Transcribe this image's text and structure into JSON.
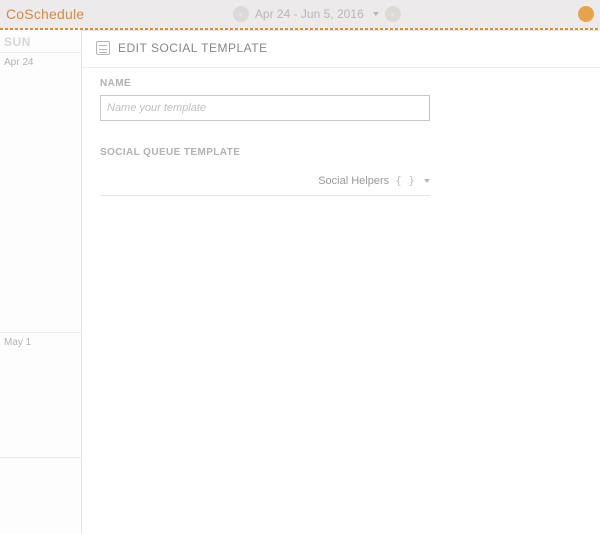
{
  "header": {
    "brand": "CoSchedule",
    "date_range": "Apr 24 - Jun 5, 2016"
  },
  "sidebar": {
    "day_label": "SUN",
    "dates": [
      "Apr 24",
      "May 1"
    ]
  },
  "panel": {
    "title": "EDIT SOCIAL TEMPLATE",
    "name_label": "NAME",
    "name_placeholder": "Name your template",
    "name_value": "",
    "queue_label": "SOCIAL QUEUE TEMPLATE",
    "helpers_label": "Social Helpers",
    "braces": "{ }"
  }
}
